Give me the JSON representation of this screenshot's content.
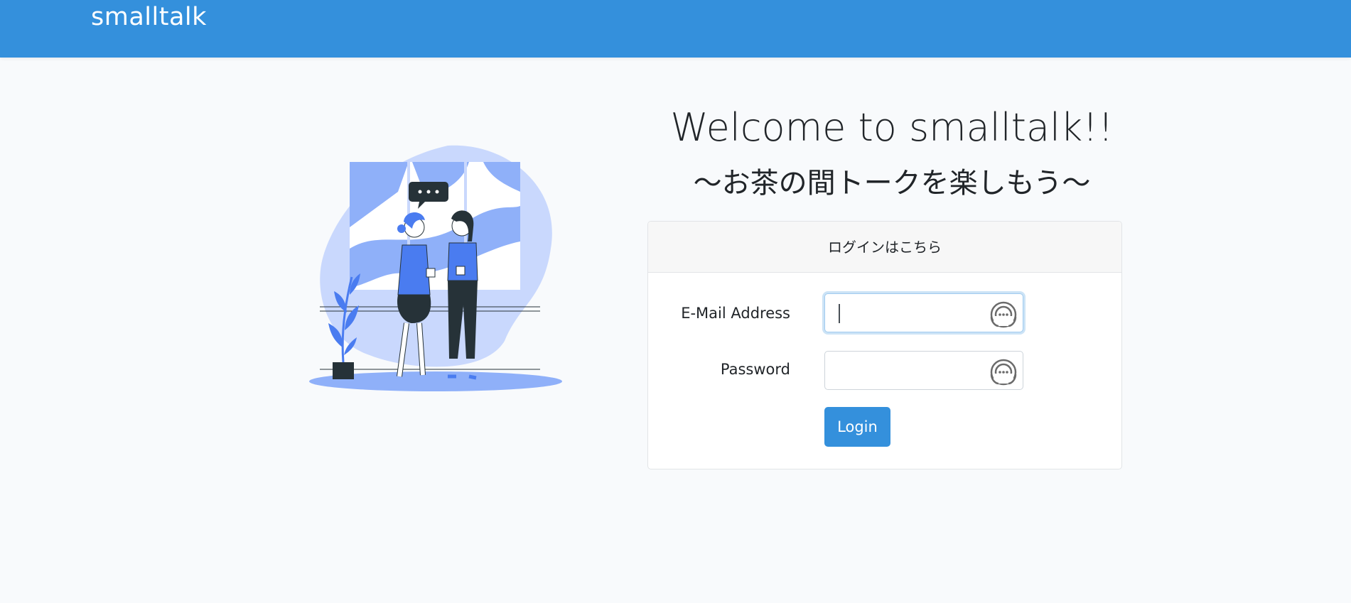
{
  "navbar": {
    "brand": "smalltalk",
    "color": "#3490dc"
  },
  "hero": {
    "welcome": "Welcome to smalltalk!!",
    "subtitle": "～お茶の間トークを楽しもう～",
    "illustration_icon": "two-people-chatting-illustration"
  },
  "login_card": {
    "header": "ログインはこちら",
    "email_label": "E-Mail Address",
    "email_value": "",
    "password_label": "Password",
    "password_value": "",
    "field_icon": "password-manager-icon",
    "login_button": "Login"
  },
  "colors": {
    "accent": "#3490dc",
    "illustration_blue": "#4a7cf0",
    "illustration_light": "#c9d8fd"
  }
}
